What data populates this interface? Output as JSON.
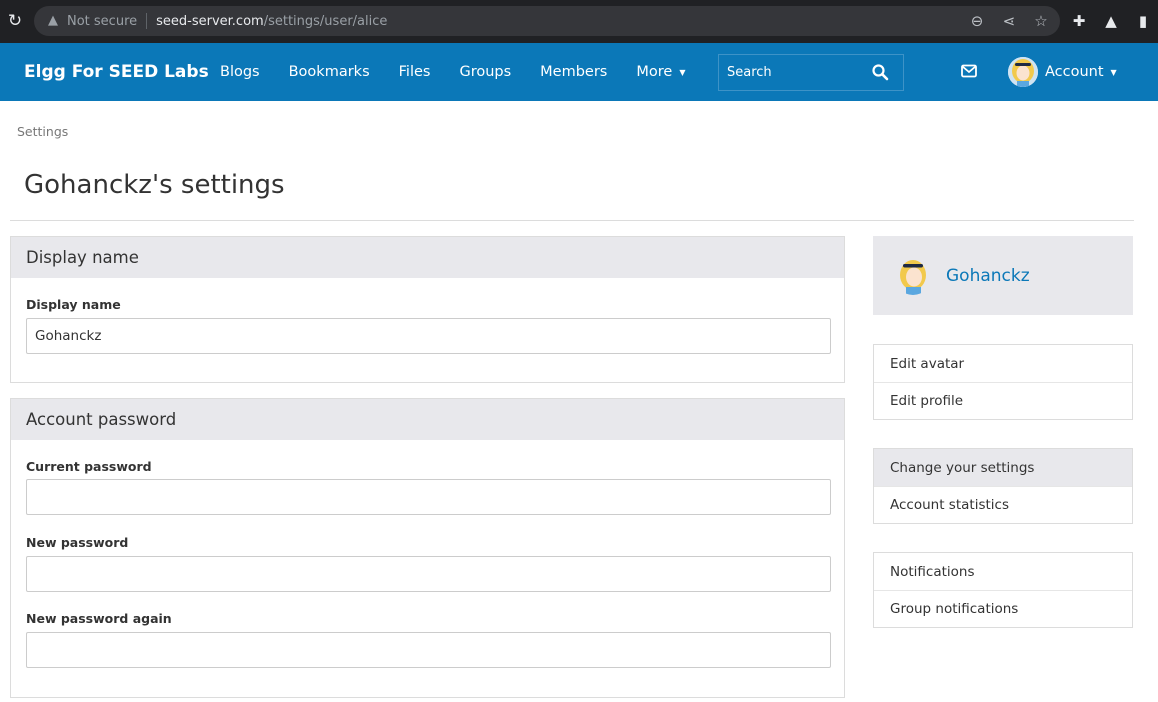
{
  "browser": {
    "security_label": "Not secure",
    "url_host": "seed-server.com",
    "url_path": "/settings/user/alice",
    "icons": [
      "reload-icon",
      "warning-icon",
      "zoom-icon",
      "share-icon",
      "bookmark-star-icon",
      "extensions-icon",
      "labs-flask-icon",
      "sidebar-icon"
    ]
  },
  "header": {
    "brand": "Elgg For SEED Labs",
    "nav": [
      {
        "label": "Blogs"
      },
      {
        "label": "Bookmarks"
      },
      {
        "label": "Files"
      },
      {
        "label": "Groups"
      },
      {
        "label": "Members"
      },
      {
        "label": "More"
      }
    ],
    "search_placeholder": "Search",
    "account_label": "Account",
    "colors": {
      "topbar": "#0b78b8",
      "link": "#0b78b8"
    }
  },
  "breadcrumb": "Settings",
  "page_title": "Gohanckz's settings",
  "display_name_module": {
    "title": "Display name",
    "field_label": "Display name",
    "value": "Gohanckz"
  },
  "password_module": {
    "title": "Account password",
    "current_label": "Current password",
    "new_label": "New password",
    "again_label": "New password again",
    "current_value": "",
    "new_value": "",
    "again_value": ""
  },
  "sidebar": {
    "owner_name": "Gohanckz",
    "menu1": [
      {
        "label": "Edit avatar"
      },
      {
        "label": "Edit profile"
      }
    ],
    "menu2": [
      {
        "label": "Change your settings",
        "selected": true
      },
      {
        "label": "Account statistics"
      }
    ],
    "menu3": [
      {
        "label": "Notifications"
      },
      {
        "label": "Group notifications"
      }
    ]
  }
}
